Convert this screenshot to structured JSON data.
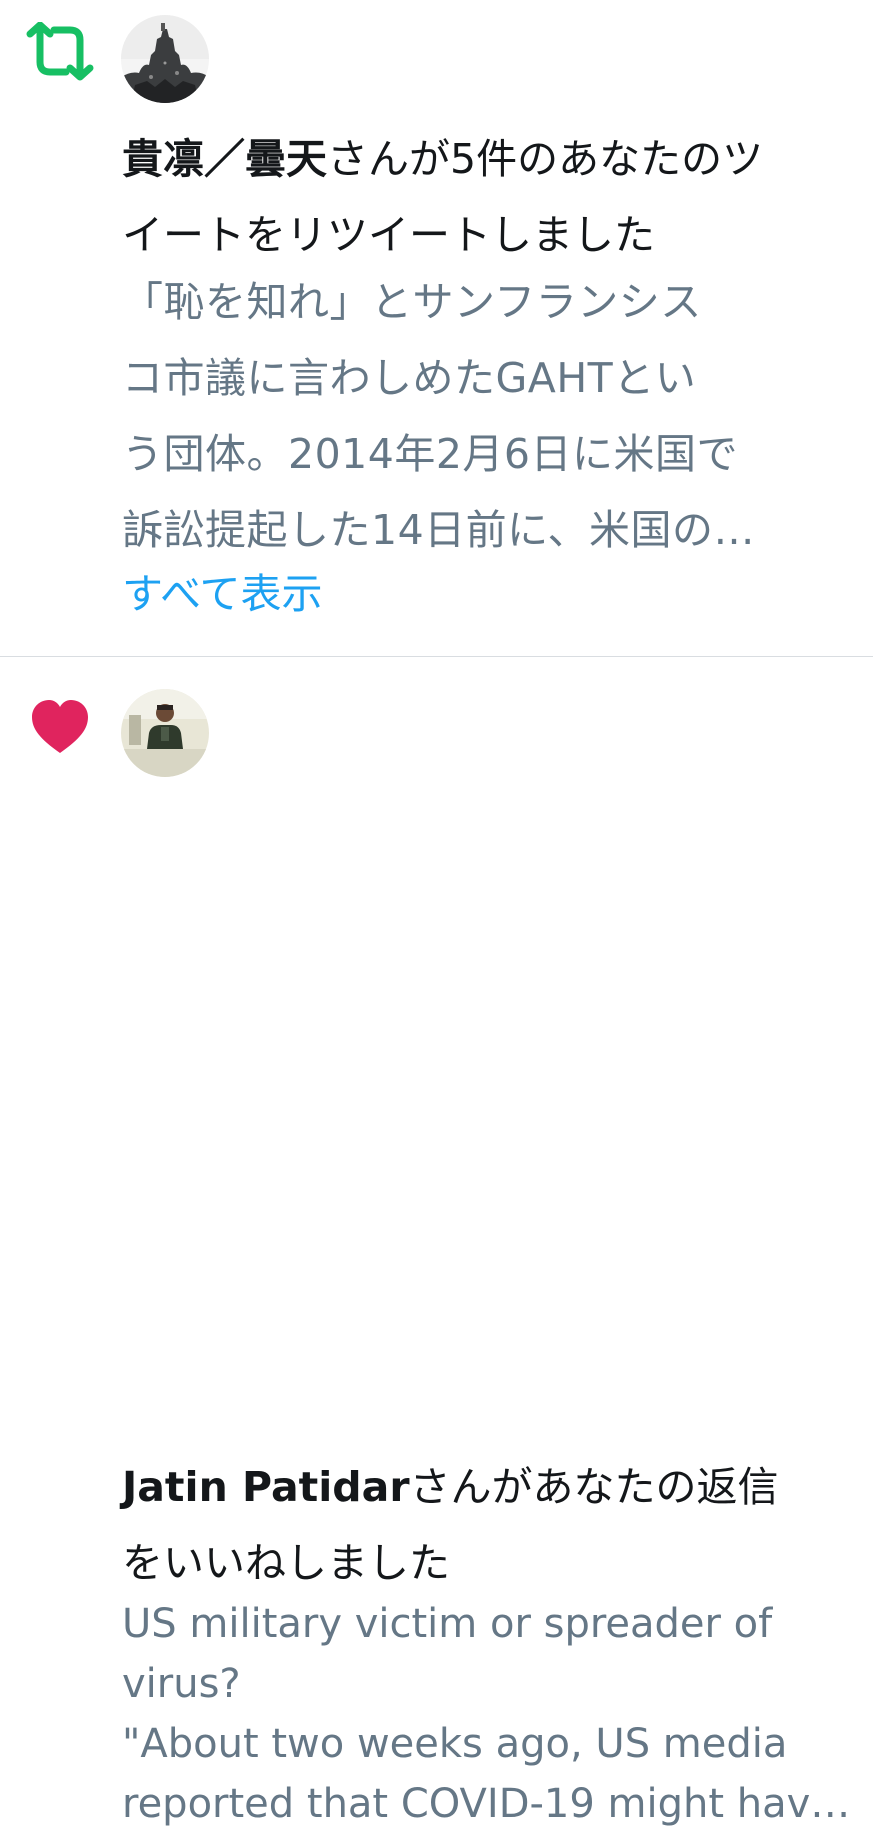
{
  "notifications": [
    {
      "type": "retweet",
      "icon": "retweet-icon",
      "icon_color": "#17bf63",
      "actor_name": "貴凛／曇天",
      "message_lines": [
        "さんが5件のあなたのツ",
        "イートをリツイートしました"
      ],
      "tweet_lines": [
        "「恥を知れ」とサンフランシス",
        "コ市議に言わしめたGAHTとい",
        "う団体。2014年2月6日に米国で",
        "訴訟提起した14日前に、米国の…"
      ],
      "show_all_label": "すべて表示"
    },
    {
      "type": "like",
      "icon": "heart-icon",
      "icon_color": "#e0245e",
      "actor_name": "Jatin Patidar",
      "message_lines": [
        "さんがあなたの返信",
        "をいいねしました"
      ],
      "tweet_lines": [
        "US military victim or spreader of",
        "virus?",
        "\"About two weeks ago, US media",
        "reported that COVID-19 might hav…"
      ]
    }
  ],
  "colors": {
    "text_primary": "#14171a",
    "text_secondary": "#657786",
    "link": "#1da1f2",
    "divider": "#d9dde1"
  }
}
